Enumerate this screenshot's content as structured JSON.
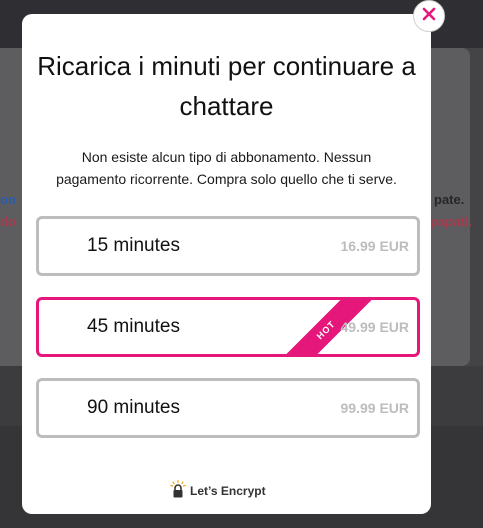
{
  "background": {
    "left_text_1": "on",
    "left_text_2": "do",
    "right_text_1": "pate.",
    "right_text_2": "papati."
  },
  "modal": {
    "title": "Ricarica i minuti per continuare a chattare",
    "subtitle": "Non esiste alcun tipo di abbonamento. Nessun pagamento ricorrente. Compra solo quello che ti serve.",
    "options": [
      {
        "label": "15 minutes",
        "price": "16.99 EUR"
      },
      {
        "label": "45 minutes",
        "price": "49.99 EUR",
        "badge": "HOT"
      },
      {
        "label": "90 minutes",
        "price": "99.99 EUR"
      }
    ],
    "footer": "Let’s Encrypt"
  },
  "colors": {
    "accent": "#e5177b",
    "border": "#bdbdbd",
    "price": "#bdbdbd"
  }
}
